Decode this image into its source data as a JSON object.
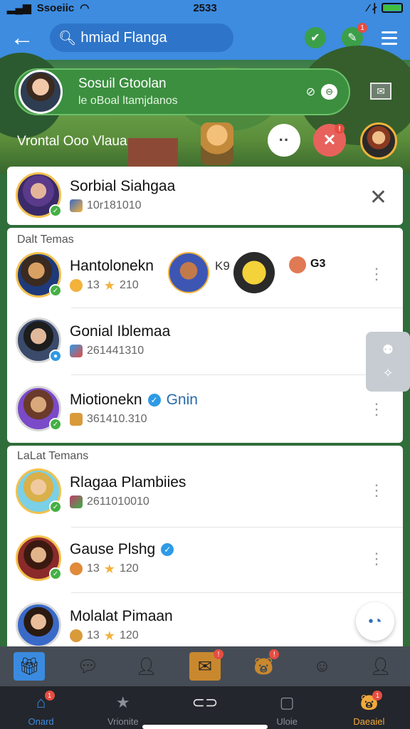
{
  "status": {
    "carrier": "Ssoeiic",
    "time": "2533",
    "signal": "⁄ ∤"
  },
  "header": {
    "search_text": "hmiad Flanga",
    "badge_count": "1"
  },
  "profile_card": {
    "name": "Sosuil Gtoolan",
    "subtitle": "le oBoal ltamjdanos",
    "chip_icon": "⊖"
  },
  "scene": {
    "label": "Vrontal Ooo Vlaua",
    "badge": "!"
  },
  "pinned": {
    "name": "Sorbial Siahgaa",
    "stat": "10r181010"
  },
  "sections": [
    {
      "title": "Dalt Temas",
      "rows": [
        {
          "name": "Hantolonekn",
          "coins": "13",
          "points": "210",
          "tag": "K9",
          "extra": "G3"
        },
        {
          "name": "Gonial Iblemaa",
          "stat": "261441310"
        },
        {
          "name": "Miotionekn",
          "stat": "361410.310",
          "tag": "Gnin"
        }
      ]
    },
    {
      "title": "LaLat Temans",
      "rows": [
        {
          "name": "Rlagaa Plambiies",
          "stat": "2611010010"
        },
        {
          "name": "Gause Plshg",
          "coins": "13",
          "points": "120"
        },
        {
          "name": "Molalat Pimaan",
          "coins": "13",
          "points": "120"
        }
      ]
    }
  ],
  "nav": [
    {
      "label": "Onard",
      "badge": "1"
    },
    {
      "label": "Vrionite"
    },
    {
      "label": ""
    },
    {
      "label": "Uloie"
    },
    {
      "label": "Daeaiel",
      "badge": "1"
    }
  ],
  "colors": {
    "primary": "#3d8ce0",
    "green": "#3b8f3f",
    "gold": "#f3b23a",
    "red": "#e54d42"
  }
}
